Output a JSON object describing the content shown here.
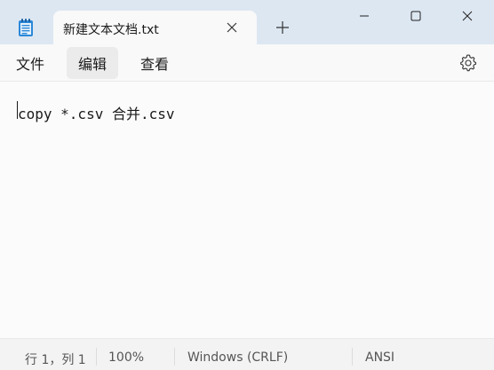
{
  "window": {
    "tab_title": "新建文本文档.txt"
  },
  "icons": {
    "app": "notepad-icon",
    "tab_close": "close-icon",
    "new_tab": "plus-icon",
    "minimize": "minimize-icon",
    "maximize": "maximize-icon",
    "close": "close-icon",
    "settings": "gear-icon"
  },
  "menu": {
    "file": "文件",
    "edit": "编辑",
    "view": "查看"
  },
  "editor": {
    "content": "copy *.csv 合并.csv"
  },
  "status": {
    "position": "行 1，列 1",
    "zoom": "100%",
    "line_ending": "Windows (CRLF)",
    "encoding": "ANSI"
  },
  "colors": {
    "titlebar": "#dde7f2",
    "accent": "#1e8fe0"
  }
}
